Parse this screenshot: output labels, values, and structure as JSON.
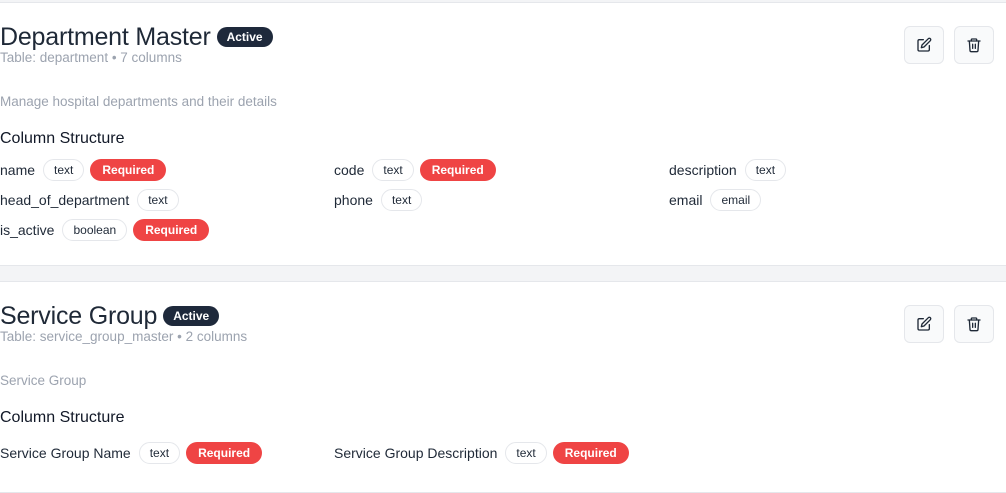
{
  "cards": [
    {
      "title": "Department Master",
      "status": "Active",
      "table_info": "Table: department • 7 columns",
      "description": "Manage hospital departments and their details",
      "columns_heading": "Column Structure",
      "fields": [
        {
          "name": "name",
          "type": "text",
          "required": "Required"
        },
        {
          "name": "code",
          "type": "text",
          "required": "Required"
        },
        {
          "name": "description",
          "type": "text"
        },
        {
          "name": "head_of_department",
          "type": "text"
        },
        {
          "name": "phone",
          "type": "text"
        },
        {
          "name": "email",
          "type": "email"
        },
        {
          "name": "is_active",
          "type": "boolean",
          "required": "Required"
        }
      ]
    },
    {
      "title": "Service Group",
      "status": "Active",
      "table_info": "Table: service_group_master • 2 columns",
      "description": "Service Group",
      "columns_heading": "Column Structure",
      "fields": [
        {
          "name": "Service Group Name",
          "type": "text",
          "required": "Required"
        },
        {
          "name": "Service Group Description",
          "type": "text",
          "required": "Required"
        }
      ]
    }
  ],
  "icons": {
    "edit": "edit-icon",
    "delete": "trash-icon"
  },
  "colors": {
    "badge": "#1e293b",
    "required": "#ef4444"
  }
}
